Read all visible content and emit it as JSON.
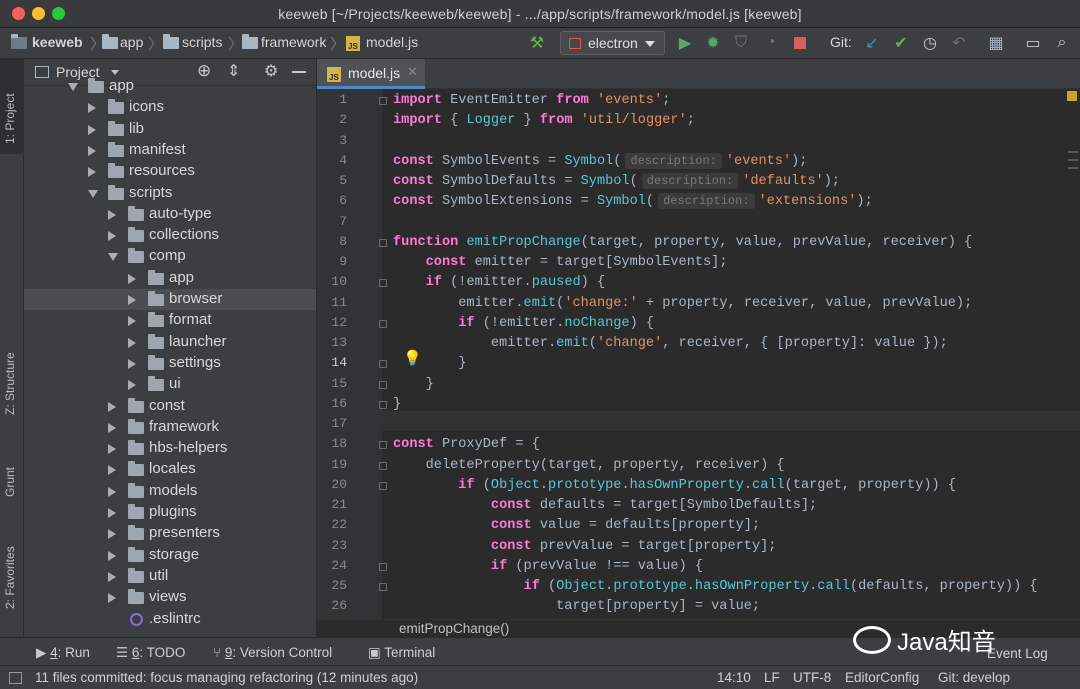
{
  "window": {
    "title": "keeweb [~/Projects/keeweb/keeweb] - .../app/scripts/framework/model.js [keeweb]",
    "traffic_lights": [
      "#ff5f57",
      "#febc2e",
      "#28c840"
    ]
  },
  "navbar": {
    "crumbs": [
      "keeweb",
      "app",
      "scripts",
      "framework",
      "model.js"
    ],
    "run_config": "electron",
    "git_label": "Git:",
    "icons": [
      "hammer-icon",
      "run-icon",
      "debug-icon",
      "coverage-icon",
      "profile-icon",
      "stop-icon",
      "git-update-icon",
      "git-commit-icon",
      "history-icon",
      "revert-icon",
      "project-structure-icon",
      "presentation-icon",
      "search-icon"
    ]
  },
  "left_strip": {
    "tabs": [
      "1: Project",
      "Z: Structure",
      "Grunt",
      "2: Favorites"
    ]
  },
  "project": {
    "header": "Project",
    "tree": [
      {
        "label": "app",
        "depth": 1,
        "type": "folder-open"
      },
      {
        "label": "icons",
        "depth": 2,
        "type": "folder"
      },
      {
        "label": "lib",
        "depth": 2,
        "type": "folder"
      },
      {
        "label": "manifest",
        "depth": 2,
        "type": "folder"
      },
      {
        "label": "resources",
        "depth": 2,
        "type": "folder"
      },
      {
        "label": "scripts",
        "depth": 2,
        "type": "folder-open"
      },
      {
        "label": "auto-type",
        "depth": 3,
        "type": "folder"
      },
      {
        "label": "collections",
        "depth": 3,
        "type": "folder"
      },
      {
        "label": "comp",
        "depth": 3,
        "type": "folder-open"
      },
      {
        "label": "app",
        "depth": 4,
        "type": "folder"
      },
      {
        "label": "browser",
        "depth": 4,
        "type": "folder",
        "selected": true
      },
      {
        "label": "format",
        "depth": 4,
        "type": "folder"
      },
      {
        "label": "launcher",
        "depth": 4,
        "type": "folder"
      },
      {
        "label": "settings",
        "depth": 4,
        "type": "folder"
      },
      {
        "label": "ui",
        "depth": 4,
        "type": "folder"
      },
      {
        "label": "const",
        "depth": 3,
        "type": "folder"
      },
      {
        "label": "framework",
        "depth": 3,
        "type": "folder"
      },
      {
        "label": "hbs-helpers",
        "depth": 3,
        "type": "folder"
      },
      {
        "label": "locales",
        "depth": 3,
        "type": "folder"
      },
      {
        "label": "models",
        "depth": 3,
        "type": "folder"
      },
      {
        "label": "plugins",
        "depth": 3,
        "type": "folder"
      },
      {
        "label": "presenters",
        "depth": 3,
        "type": "folder"
      },
      {
        "label": "storage",
        "depth": 3,
        "type": "folder"
      },
      {
        "label": "util",
        "depth": 3,
        "type": "folder"
      },
      {
        "label": "views",
        "depth": 3,
        "type": "folder"
      },
      {
        "label": ".eslintrc",
        "depth": 3,
        "type": "file"
      }
    ]
  },
  "editor": {
    "tab": "model.js",
    "function_breadcrumb": "emitPropChange()",
    "current_line": 14,
    "lines": [
      {
        "n": 1,
        "html": "<span class='kw'>import</span> EventEmitter <span class='kw'>from</span> <span class='str'>'events'</span>;"
      },
      {
        "n": 2,
        "html": "<span class='kw'>import</span> { <span class='cy'>Logger</span> } <span class='kw'>from</span> <span class='str'>'util/logger'</span>;"
      },
      {
        "n": 3,
        "html": ""
      },
      {
        "n": 4,
        "html": "<span class='kw'>const</span> SymbolEvents = <span class='cy'>Symbol</span>(<span class='hint'>description:</span><span class='str'>'events'</span>);"
      },
      {
        "n": 5,
        "html": "<span class='kw'>const</span> SymbolDefaults = <span class='cy'>Symbol</span>(<span class='hint'>description:</span><span class='str'>'defaults'</span>);"
      },
      {
        "n": 6,
        "html": "<span class='kw'>const</span> SymbolExtensions = <span class='cy'>Symbol</span>(<span class='hint'>description:</span><span class='str'>'extensions'</span>);"
      },
      {
        "n": 7,
        "html": ""
      },
      {
        "n": 8,
        "html": "<span class='kw'>function</span> <span class='cy'>emitPropChange</span>(target, property, value, prevValue, receiver) {"
      },
      {
        "n": 9,
        "html": "    <span class='kw'>const</span> emitter = target[SymbolEvents];"
      },
      {
        "n": 10,
        "html": "    <span class='kw'>if</span> (!emitter.<span class='prop'>paused</span>) {"
      },
      {
        "n": 11,
        "html": "        emitter.<span class='cy'>emit</span>(<span class='str'>'change:'</span> + property, receiver, value, prevValue);"
      },
      {
        "n": 12,
        "html": "        <span class='kw'>if</span> (!emitter.<span class='prop'>noChange</span>) {"
      },
      {
        "n": 13,
        "html": "            emitter.<span class='cy'>emit</span>(<span class='str'>'change'</span>, receiver, { [property]: value });"
      },
      {
        "n": 14,
        "html": "        }"
      },
      {
        "n": 15,
        "html": "    }"
      },
      {
        "n": 16,
        "html": "}"
      },
      {
        "n": 17,
        "html": ""
      },
      {
        "n": 18,
        "html": "<span class='kw'>const</span> ProxyDef = {"
      },
      {
        "n": 19,
        "html": "    <span style='color:#a9b7c6'>deleteProperty</span>(target, property, receiver) {"
      },
      {
        "n": 20,
        "html": "        <span class='kw'>if</span> (<span class='cy'>Object</span>.<span class='prop'>prototype</span>.<span class='cy'>hasOwnProperty</span>.<span class='cy'>call</span>(target, property)) {"
      },
      {
        "n": 21,
        "html": "            <span class='kw'>const</span> defaults = target[SymbolDefaults];"
      },
      {
        "n": 22,
        "html": "            <span class='kw'>const</span> value = defaults[property];"
      },
      {
        "n": 23,
        "html": "            <span class='kw'>const</span> prevValue = target[property];"
      },
      {
        "n": 24,
        "html": "            <span class='kw'>if</span> (prevValue !== value) {"
      },
      {
        "n": 25,
        "html": "                <span class='kw'>if</span> (<span class='cy'>Object</span>.<span class='prop'>prototype</span>.<span class='cy'>hasOwnProperty</span>.<span class='cy'>call</span>(defaults, property)) {"
      },
      {
        "n": 26,
        "html": "                    target[property] = value;"
      }
    ]
  },
  "bottom_tabs": [
    {
      "key": "4",
      "label": ": Run",
      "icon": "run-icon"
    },
    {
      "key": "6",
      "label": ": TODO",
      "icon": "todo-icon"
    },
    {
      "key": "9",
      "label": ": Version Control",
      "icon": "vcs-icon"
    },
    {
      "key": "",
      "label": "Terminal",
      "icon": "terminal-icon"
    }
  ],
  "event_log": "Event Log",
  "status": {
    "message": "11 files committed: focus managing refactoring (12 minutes ago)",
    "position": "14:10",
    "line_sep": "LF",
    "encoding": "UTF-8",
    "editorconfig": "EditorConfig",
    "git_branch": "Git: develop"
  },
  "watermark": "Java知音"
}
